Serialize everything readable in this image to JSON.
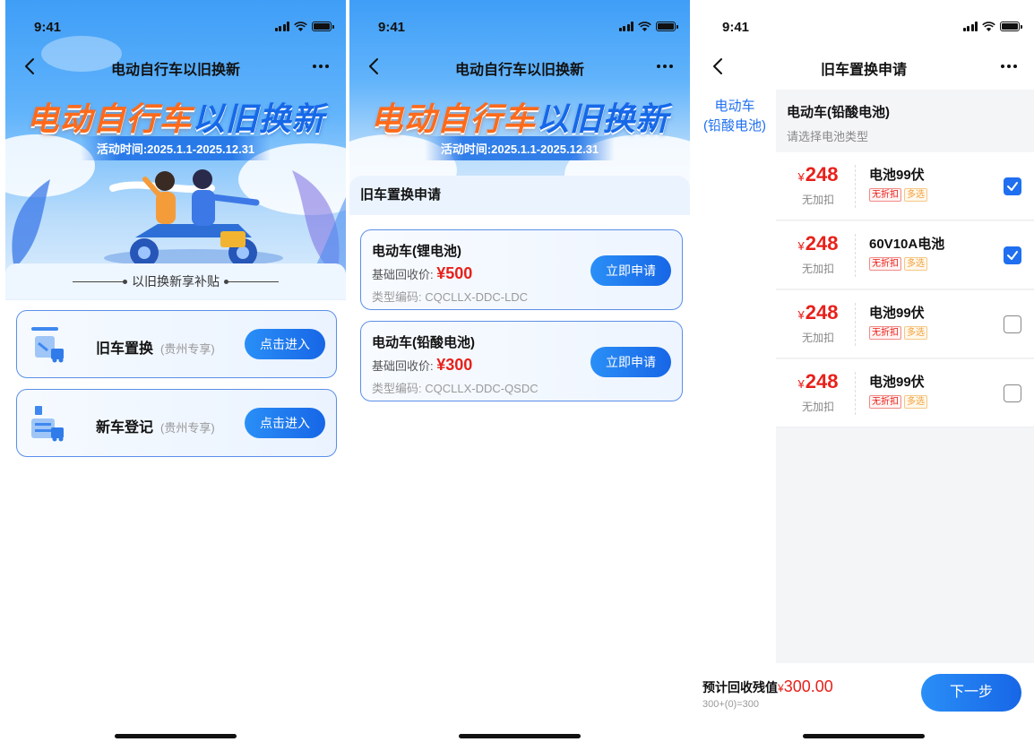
{
  "status": {
    "time": "9:41"
  },
  "screen1": {
    "nav_title": "电动自行车以旧换新",
    "hero_title_a": "电动自行车",
    "hero_title_b": "以旧换新",
    "hero_date": "活动时间:2025.1.1-2025.12.31",
    "subsidy_label": "以旧换新享补贴",
    "cards": [
      {
        "name": "旧车置换",
        "tag": "(贵州专享)",
        "button": "点击进入",
        "icon": "vehicle-exchange-icon"
      },
      {
        "name": "新车登记",
        "tag": "(贵州专享)",
        "button": "点击进入",
        "icon": "vehicle-register-icon"
      }
    ]
  },
  "screen2": {
    "nav_title": "电动自行车以旧换新",
    "hero_title_a": "电动自行车",
    "hero_title_b": "以旧换新",
    "hero_date": "活动时间:2025.1.1-2025.12.31",
    "section_title": "旧车置换申请",
    "cards": [
      {
        "name": "电动车(锂电池)",
        "price_label": "基础回收价:",
        "price": "¥500",
        "code": "类型编码: CQCLLX-DDC-LDC",
        "button": "立即申请"
      },
      {
        "name": "电动车(铅酸电池)",
        "price_label": "基础回收价:",
        "price": "¥300",
        "code": "类型编码: CQCLLX-DDC-QSDC",
        "button": "立即申请"
      }
    ]
  },
  "screen3": {
    "nav_title": "旧车置换申请",
    "left_nav": [
      "电动车",
      "(铅酸电池)"
    ],
    "section_title": "电动车(铅酸电池)",
    "section_sub": "请选择电池类型",
    "options": [
      {
        "currency": "¥",
        "price": "248",
        "note": "无加扣",
        "name": "电池99伏",
        "tag1": "无折扣",
        "tag2": "多选",
        "checked": true
      },
      {
        "currency": "¥",
        "price": "248",
        "note": "无加扣",
        "name": "60V10A电池",
        "tag1": "无折扣",
        "tag2": "多选",
        "checked": true
      },
      {
        "currency": "¥",
        "price": "248",
        "note": "无加扣",
        "name": "电池99伏",
        "tag1": "无折扣",
        "tag2": "多选",
        "checked": false
      },
      {
        "currency": "¥",
        "price": "248",
        "note": "无加扣",
        "name": "电池99伏",
        "tag1": "无折扣",
        "tag2": "多选",
        "checked": false
      }
    ],
    "bottom_label": "预计回收残值",
    "bottom_currency": "¥",
    "bottom_amount": "300.00",
    "formula": "300+(0)=300",
    "next_button": "下一步"
  },
  "colors": {
    "accent": "#1f6ff0",
    "price_red": "#e8201a",
    "hero_orange": "#ff6a1a"
  }
}
